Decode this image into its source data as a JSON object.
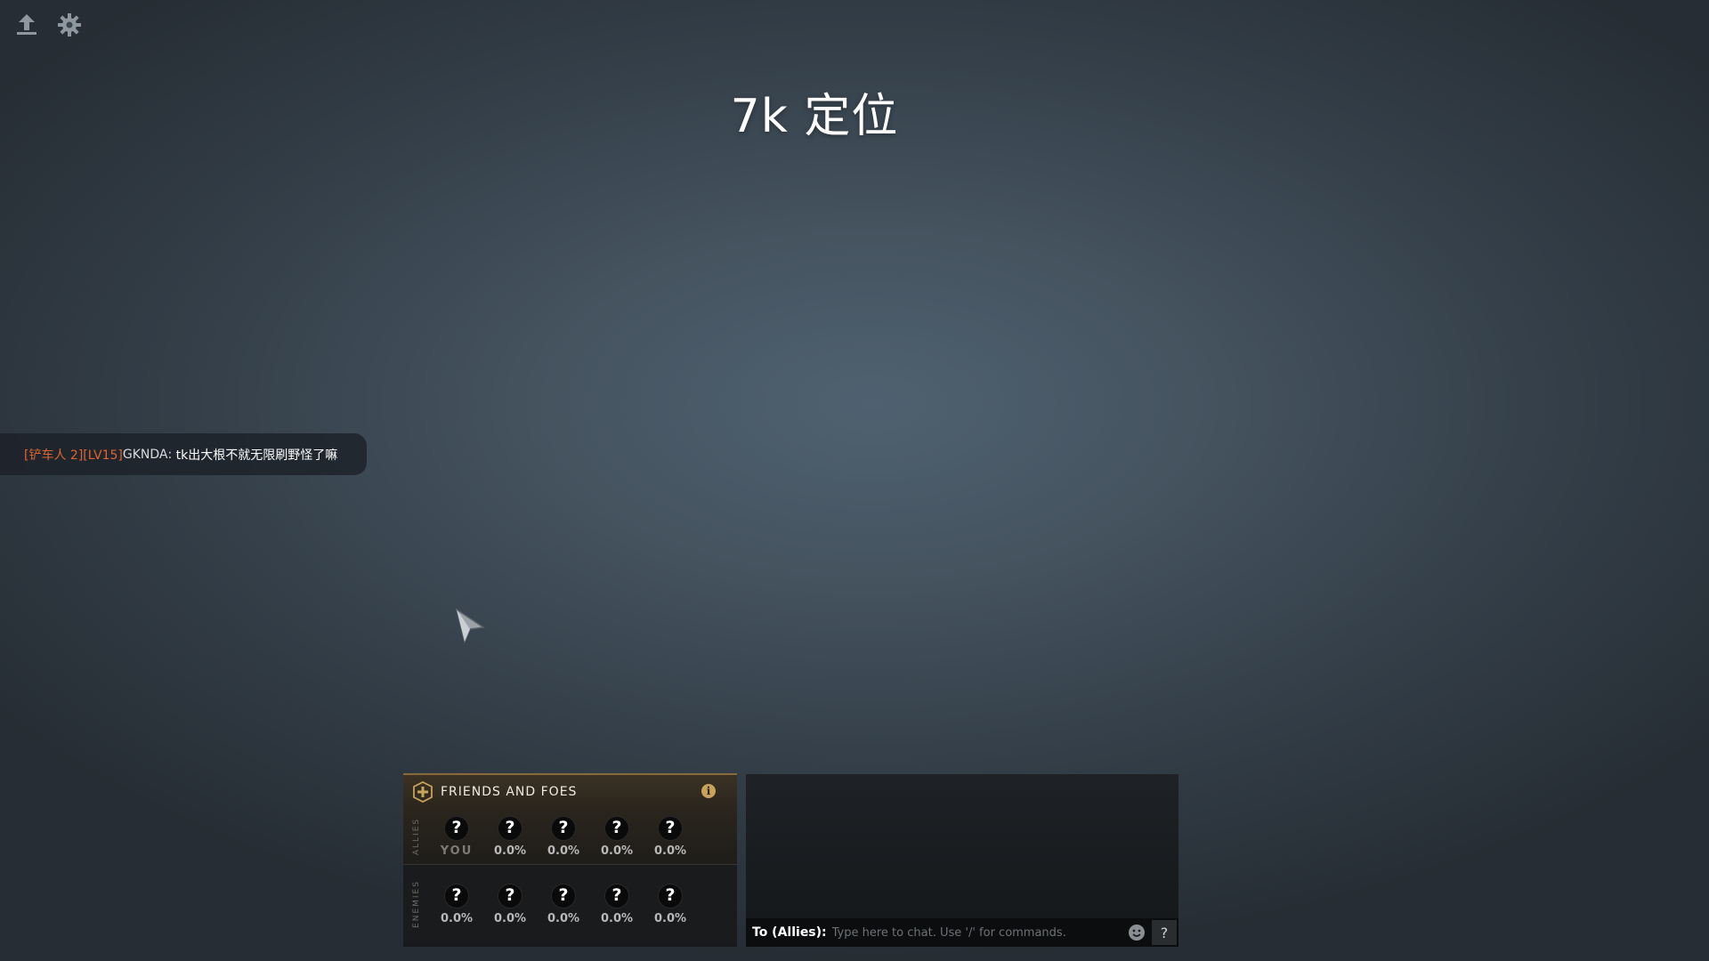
{
  "top_bar": {
    "icons": [
      "upload-icon",
      "gear-icon"
    ]
  },
  "headline": "7k 定位",
  "chat_bubble": {
    "tag": "[铲车人 2][LV15]",
    "name": "GKNDA",
    "separator": ":",
    "message": "tk出大根不就无限刷野怪了嘛",
    "tag_color": "#e0642e"
  },
  "friends_and_foes": {
    "title": "FRIENDS AND FOES",
    "info_label": "i",
    "allies_label": "ALLIES",
    "enemies_label": "ENEMIES",
    "allies": [
      {
        "icon": "?",
        "value": "YOU"
      },
      {
        "icon": "?",
        "value": "0.0%"
      },
      {
        "icon": "?",
        "value": "0.0%"
      },
      {
        "icon": "?",
        "value": "0.0%"
      },
      {
        "icon": "?",
        "value": "0.0%"
      }
    ],
    "enemies": [
      {
        "icon": "?",
        "value": "0.0%"
      },
      {
        "icon": "?",
        "value": "0.0%"
      },
      {
        "icon": "?",
        "value": "0.0%"
      },
      {
        "icon": "?",
        "value": "0.0%"
      },
      {
        "icon": "?",
        "value": "0.0%"
      }
    ],
    "accent_color": "#8a6a3a"
  },
  "chat": {
    "target_label": "To (Allies):",
    "placeholder": "Type here to chat. Use '/' for commands.",
    "help_label": "?"
  }
}
